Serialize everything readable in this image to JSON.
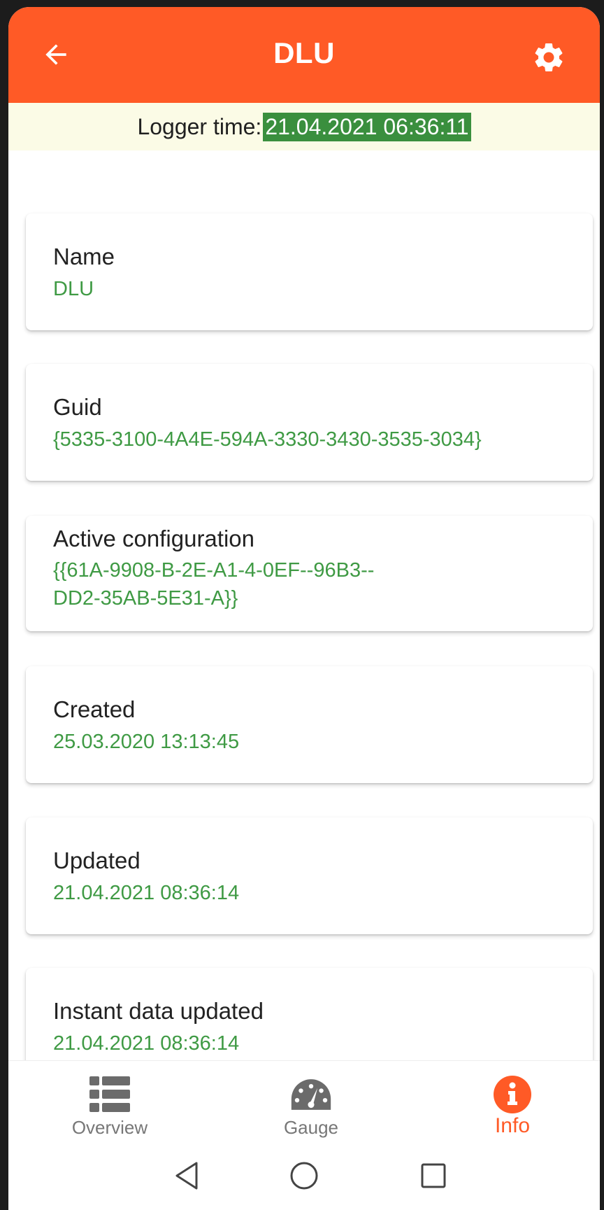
{
  "header": {
    "title": "DLU",
    "back_icon": "arrow-left-icon",
    "settings_icon": "gear-icon",
    "color": "#ff5a26"
  },
  "logger": {
    "label": "Logger time:",
    "time": "21.04.2021 06:36:11",
    "highlight_color": "#3a8f3e",
    "background": "#fbfbe6"
  },
  "cards": [
    {
      "label": "Name",
      "value": "DLU"
    },
    {
      "label": "Guid",
      "value": "{5335-3100-4A4E-594A-3330-3430-3535-3034}"
    },
    {
      "label": "Active configuration",
      "value": "{{61A-9908-B-2E-A1-4-0EF--96B3--DD2-35AB-5E31-A}}"
    },
    {
      "label": "Created",
      "value": "25.03.2020 13:13:45"
    },
    {
      "label": "Updated",
      "value": "21.04.2021 08:36:14"
    },
    {
      "label": "Instant data updated",
      "value": "21.04.2021 08:36:14"
    }
  ],
  "value_color": "#3f9a44",
  "bottom_nav": {
    "items": [
      {
        "label": "Overview",
        "icon": "list-icon"
      },
      {
        "label": "Gauge",
        "icon": "gauge-icon"
      },
      {
        "label": "Info",
        "icon": "info-icon",
        "active": true
      }
    ]
  },
  "system_nav": {
    "back_icon": "triangle-back-icon",
    "home_icon": "circle-home-icon",
    "recents_icon": "square-recents-icon"
  }
}
